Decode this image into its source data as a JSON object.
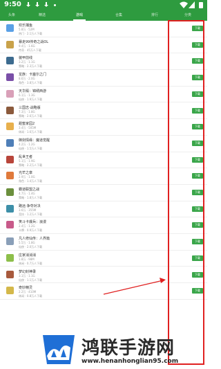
{
  "status_bar": {
    "time": "9:50"
  },
  "tabs": [
    {
      "label": "头条"
    },
    {
      "label": "精选"
    },
    {
      "label": "游戏"
    },
    {
      "label": "合集"
    },
    {
      "label": "排行"
    },
    {
      "label": "分类"
    }
  ],
  "download_label": "下载",
  "games": [
    {
      "name": "欢乐捕鱼",
      "meta": "5.8万 · 52M",
      "meta2": "热门 · 2.1万人下载",
      "color": "#5aa0e6"
    },
    {
      "name": "暴走99传奇之战OL",
      "meta": "9.4万 · 1.6G",
      "meta2": "传奇 · 45万人下载",
      "color": "#c9a24a"
    },
    {
      "name": "装甲前线",
      "meta": "3.2万 · 1.1G",
      "meta2": "策略 · 2.3万人下载",
      "color": "#3d6b8f"
    },
    {
      "name": "龙族：卡塞尔之门",
      "meta": "8.6万 · 2.0G",
      "meta2": "角色 · 3.8万人下载",
      "color": "#7a4fa8"
    },
    {
      "name": "天华殿：锦绣西游",
      "meta": "6.1万 · 1.3G",
      "meta2": "仙侠 · 1.9万人下载",
      "color": "#d9a0b8"
    },
    {
      "name": "三国志·战略版",
      "meta": "7.3万 · 1.8G",
      "meta2": "策略 · 2.6万人下载",
      "color": "#8b5a3c"
    },
    {
      "name": "甜蜜家园2",
      "meta": "3.4万 · 505M",
      "meta2": "休闲 · 1.6万人下载",
      "color": "#e8b04d"
    },
    {
      "name": "御剑情缘：魔道觉醒",
      "meta": "4.2万 · 1.2G",
      "meta2": "仙侠 · 1.5万人下载",
      "color": "#4f7fb8"
    },
    {
      "name": "乱世王者",
      "meta": "5.1万 · 1.9G",
      "meta2": "策略 · 2.2万人下载",
      "color": "#b8453a"
    },
    {
      "name": "光芒之章",
      "meta": "2.9万 · 1.0G",
      "meta2": "角色 · 1.4万人下载",
      "color": "#e07a3c"
    },
    {
      "name": "霸道联盟之战",
      "meta": "4.7万 · 1.4G",
      "meta2": "策略 · 1.8万人下载",
      "color": "#6b8f3d"
    },
    {
      "name": "路远·争夺对决",
      "meta": "3.6万 · 355M",
      "meta2": "竞技 · 1.2万人下载",
      "color": "#3d8fa8"
    },
    {
      "name": "笑斗卡爆兵：浪漫",
      "meta": "2.4万 · 1.2G",
      "meta2": "卡牌 · 0.9万人下载",
      "color": "#c85a8a"
    },
    {
      "name": "凡人修仙传：人界篇",
      "meta": "5.5万 · 1.8G",
      "meta2": "仙侠 · 2.0万人下载",
      "color": "#8a9fb8"
    },
    {
      "name": "庄家消消消",
      "meta": "1.8万 · 98M",
      "meta2": "休闲 · 0.7万人下载",
      "color": "#8dbf4a"
    },
    {
      "name": "梦幻封神录",
      "meta": "3.1万 · 1.1G",
      "meta2": "仙侠 · 1.1万人下载",
      "color": "#a85a3d"
    },
    {
      "name": "奇妙精灵",
      "meta": "2.2万 · 410M",
      "meta2": "休闲 · 0.8万人下载",
      "color": "#d4b84a"
    }
  ],
  "watermark": {
    "title": "鸿联手游网",
    "url": "www.henanhonglian95.com"
  },
  "colors": {
    "accent": "#2e9b3f",
    "download": "#3aa64a",
    "annotation": "#e02020"
  }
}
